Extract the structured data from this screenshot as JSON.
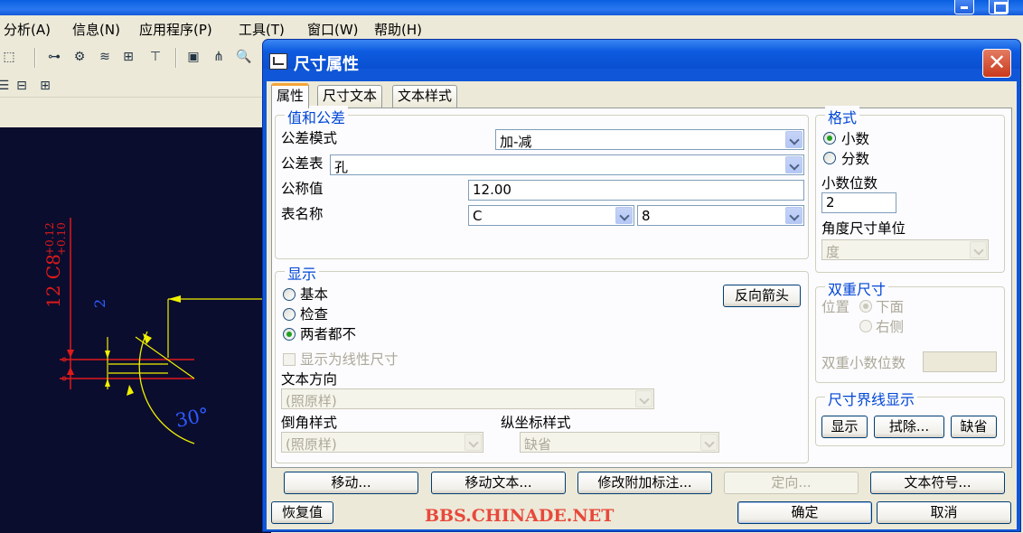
{
  "menu": [
    "分析(A)",
    "信息(N)",
    "应用程序(P)",
    "工具(T)",
    "窗口(W)",
    "帮助(H)"
  ],
  "drawing": {
    "dim_text_vertical": "12 C8",
    "tol_upper": "+0.12",
    "tol_lower": "+0.10",
    "dim_small": "2",
    "angle_text": "30°"
  },
  "dialog": {
    "title": "尺寸属性",
    "close_glyph": "✕",
    "tabs": [
      "属性",
      "尺寸文本",
      "文本样式"
    ],
    "value_tolerance": {
      "title": "值和公差",
      "tolerance_mode_label": "公差模式",
      "tolerance_mode_value": "加-减",
      "tolerance_table_label": "公差表",
      "tolerance_table_value": "孔",
      "nominal_label": "公称值",
      "nominal_value": "12.00",
      "table_name_label": "表名称",
      "table_name_value1": "C",
      "table_name_value2": "8"
    },
    "format": {
      "title": "格式",
      "decimal": "小数",
      "fraction": "分数",
      "decimal_places_label": "小数位数",
      "decimal_places_value": "2",
      "angle_unit_label": "角度尺寸单位",
      "angle_unit_value": "度"
    },
    "display": {
      "title": "显示",
      "basic": "基本",
      "inspection": "检查",
      "neither": "两者都不",
      "flip_arrows": "反向箭头",
      "show_linear": "显示为线性尺寸",
      "text_orientation_label": "文本方向",
      "text_orientation_value": "(照原样)",
      "chamfer_style_label": "倒角样式",
      "chamfer_style_value": "(照原样)",
      "ordinate_style_label": "纵坐标样式",
      "ordinate_style_value": "缺省"
    },
    "dual": {
      "title": "双重尺寸",
      "position_label": "位置",
      "below": "下面",
      "right": "右侧",
      "dual_decimal_label": "双重小数位数"
    },
    "witness": {
      "title": "尺寸界线显示",
      "show": "显示",
      "erase": "拭除...",
      "default": "缺省"
    },
    "buttons": {
      "move": "移动...",
      "move_text": "移动文本...",
      "modify_attached": "修改附加标注...",
      "orient": "定向...",
      "text_symbol": "文本符号...",
      "restore": "恢复值",
      "ok": "确定",
      "cancel": "取消"
    }
  },
  "watermark": "BBS.CHINADE.NET",
  "colors": {
    "canvas_bg": "#0b0d2e",
    "dimension_red": "#e01a1a",
    "angle_blue": "#2c5bff",
    "arc_yellow": "#f0f000",
    "group_title_blue": "#0046d5",
    "dialog_title_blue": "#0f57d8"
  }
}
